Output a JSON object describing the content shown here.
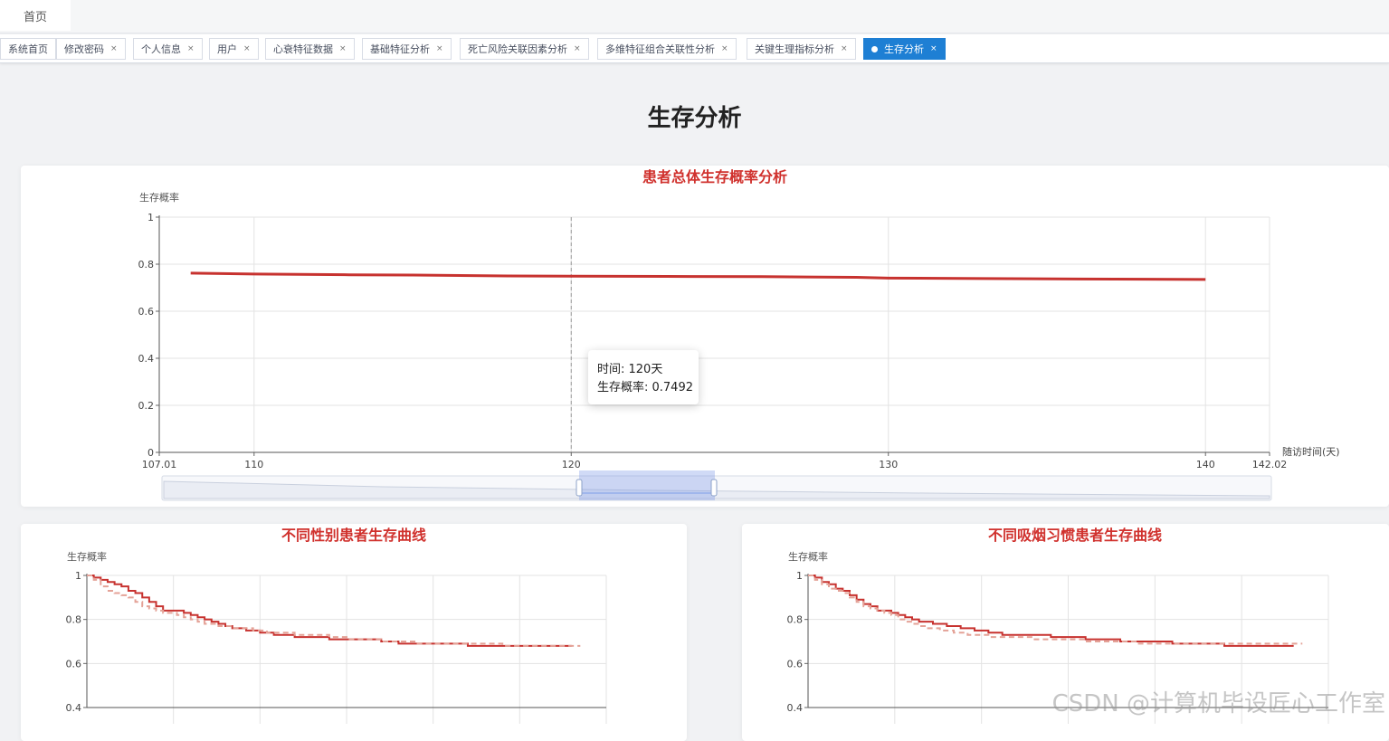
{
  "nav": {
    "home": "首页"
  },
  "tabs": [
    {
      "label": "系统首页",
      "closable": false,
      "active": false
    },
    {
      "label": "修改密码",
      "closable": true,
      "active": false
    },
    {
      "label": "个人信息",
      "closable": true,
      "active": false
    },
    {
      "label": "用户",
      "closable": true,
      "active": false
    },
    {
      "label": "心衰特征数据",
      "closable": true,
      "active": false
    },
    {
      "label": "基础特征分析",
      "closable": true,
      "active": false
    },
    {
      "label": "死亡风险关联因素分析",
      "closable": true,
      "active": false
    },
    {
      "label": "多维特征组合关联性分析",
      "closable": true,
      "active": false
    },
    {
      "label": "关键生理指标分析",
      "closable": true,
      "active": false
    },
    {
      "label": "生存分析",
      "closable": true,
      "active": true
    }
  ],
  "tab_close_glyph": "×",
  "page": {
    "title": "生存分析"
  },
  "colors": {
    "accent": "#1e7fd4",
    "title_red": "#d0312d",
    "line_red": "#c7322f",
    "line_salmon": "#e4a297"
  },
  "chart_data": [
    {
      "type": "line",
      "title": "患者总体生存概率分析",
      "ylabel": "生存概率",
      "xlabel": "随访时间(天)",
      "xlim": [
        107.01,
        142.02
      ],
      "ylim": [
        0,
        1
      ],
      "x_tick_labels": [
        "107.01",
        "110",
        "120",
        "130",
        "140",
        "142.02"
      ],
      "x_tick_values": [
        107.01,
        110,
        120,
        130,
        140,
        142.02
      ],
      "y_tick_labels": [
        "0",
        "0.2",
        "0.4",
        "0.6",
        "0.8",
        "1"
      ],
      "y_tick_values": [
        0,
        0.2,
        0.4,
        0.6,
        0.8,
        1
      ],
      "series": [
        {
          "x": [
            108,
            110,
            113,
            115,
            118,
            120,
            123,
            126,
            129,
            130,
            133,
            136,
            140
          ],
          "y": [
            0.762,
            0.758,
            0.755,
            0.754,
            0.75,
            0.7492,
            0.748,
            0.747,
            0.744,
            0.741,
            0.739,
            0.737,
            0.735
          ]
        }
      ],
      "cursor_x": 120,
      "tooltip": {
        "line1": "时间: 120天",
        "line2": "生存概率: 0.7492"
      },
      "data_zoom": true,
      "grid": true
    },
    {
      "type": "line",
      "title": "不同性别患者生存曲线",
      "ylabel": "生存概率",
      "ylim": [
        0.4,
        1
      ],
      "y_tick_labels": [
        "1",
        "0.8",
        "0.6",
        "0.4"
      ],
      "y_tick_values": [
        1,
        0.8,
        0.6,
        0.4
      ],
      "series": [
        {
          "style": "solid",
          "x": [
            0,
            4,
            8,
            12,
            16,
            20,
            24,
            28,
            32,
            36,
            40,
            44,
            48,
            52,
            56,
            60,
            64,
            68,
            72,
            76,
            80,
            84,
            88,
            92,
            96,
            100,
            104,
            108,
            112,
            120,
            130,
            140,
            150,
            160,
            170,
            180,
            190,
            200,
            210,
            220,
            230,
            240,
            250,
            260,
            270,
            280
          ],
          "y": [
            1,
            0.99,
            0.98,
            0.97,
            0.96,
            0.95,
            0.93,
            0.92,
            0.9,
            0.88,
            0.86,
            0.84,
            0.84,
            0.84,
            0.83,
            0.82,
            0.81,
            0.8,
            0.79,
            0.78,
            0.77,
            0.76,
            0.76,
            0.75,
            0.75,
            0.74,
            0.74,
            0.73,
            0.73,
            0.72,
            0.72,
            0.71,
            0.71,
            0.71,
            0.7,
            0.69,
            0.69,
            0.69,
            0.69,
            0.68,
            0.68,
            0.68,
            0.68,
            0.68,
            0.68,
            0.68
          ]
        },
        {
          "style": "dashed",
          "x": [
            0,
            4,
            8,
            12,
            16,
            20,
            24,
            28,
            32,
            36,
            40,
            44,
            48,
            52,
            56,
            60,
            64,
            68,
            72,
            76,
            80,
            84,
            88,
            92,
            96,
            100,
            104,
            108,
            112,
            120,
            130,
            140,
            150,
            160,
            170,
            180,
            190,
            200,
            210,
            220,
            230,
            240,
            250,
            260,
            270,
            285
          ],
          "y": [
            1,
            0.98,
            0.95,
            0.93,
            0.92,
            0.91,
            0.9,
            0.88,
            0.86,
            0.85,
            0.84,
            0.83,
            0.83,
            0.82,
            0.81,
            0.8,
            0.79,
            0.78,
            0.78,
            0.77,
            0.77,
            0.76,
            0.76,
            0.76,
            0.75,
            0.75,
            0.74,
            0.74,
            0.74,
            0.73,
            0.73,
            0.72,
            0.71,
            0.71,
            0.7,
            0.7,
            0.69,
            0.69,
            0.69,
            0.69,
            0.69,
            0.68,
            0.68,
            0.68,
            0.68,
            0.68
          ]
        }
      ],
      "xlim": [
        0,
        300
      ],
      "grid": true
    },
    {
      "type": "line",
      "title": "不同吸烟习惯患者生存曲线",
      "ylabel": "生存概率",
      "ylim": [
        0.4,
        1
      ],
      "y_tick_labels": [
        "1",
        "0.8",
        "0.6",
        "0.4"
      ],
      "y_tick_values": [
        1,
        0.8,
        0.6,
        0.4
      ],
      "series": [
        {
          "style": "solid",
          "x": [
            0,
            4,
            8,
            12,
            16,
            20,
            24,
            28,
            32,
            36,
            40,
            44,
            48,
            52,
            56,
            60,
            64,
            68,
            72,
            76,
            80,
            84,
            88,
            92,
            96,
            100,
            104,
            108,
            112,
            120,
            130,
            140,
            150,
            160,
            170,
            180,
            190,
            200,
            210,
            220,
            230,
            240,
            250,
            260,
            270,
            280
          ],
          "y": [
            1,
            0.99,
            0.97,
            0.96,
            0.94,
            0.93,
            0.91,
            0.89,
            0.87,
            0.86,
            0.84,
            0.84,
            0.83,
            0.82,
            0.81,
            0.8,
            0.79,
            0.79,
            0.78,
            0.78,
            0.77,
            0.77,
            0.76,
            0.76,
            0.75,
            0.75,
            0.74,
            0.74,
            0.73,
            0.73,
            0.73,
            0.72,
            0.72,
            0.71,
            0.71,
            0.7,
            0.7,
            0.7,
            0.69,
            0.69,
            0.69,
            0.68,
            0.68,
            0.68,
            0.68,
            0.68
          ]
        },
        {
          "style": "dashed",
          "x": [
            0,
            4,
            8,
            12,
            16,
            20,
            24,
            28,
            32,
            36,
            40,
            44,
            48,
            52,
            56,
            60,
            64,
            68,
            72,
            76,
            80,
            84,
            88,
            92,
            96,
            100,
            104,
            108,
            112,
            120,
            130,
            140,
            150,
            160,
            170,
            180,
            190,
            200,
            210,
            220,
            230,
            240,
            250,
            260,
            270,
            285
          ],
          "y": [
            1,
            0.98,
            0.96,
            0.94,
            0.93,
            0.92,
            0.9,
            0.88,
            0.86,
            0.85,
            0.84,
            0.83,
            0.82,
            0.8,
            0.79,
            0.78,
            0.77,
            0.76,
            0.76,
            0.75,
            0.75,
            0.74,
            0.74,
            0.73,
            0.73,
            0.73,
            0.72,
            0.72,
            0.72,
            0.72,
            0.71,
            0.71,
            0.71,
            0.7,
            0.7,
            0.7,
            0.69,
            0.69,
            0.69,
            0.69,
            0.69,
            0.69,
            0.69,
            0.69,
            0.69,
            0.69
          ]
        }
      ],
      "xlim": [
        0,
        300
      ],
      "grid": true
    }
  ],
  "watermark": "CSDN @计算机毕设匠心工作室"
}
